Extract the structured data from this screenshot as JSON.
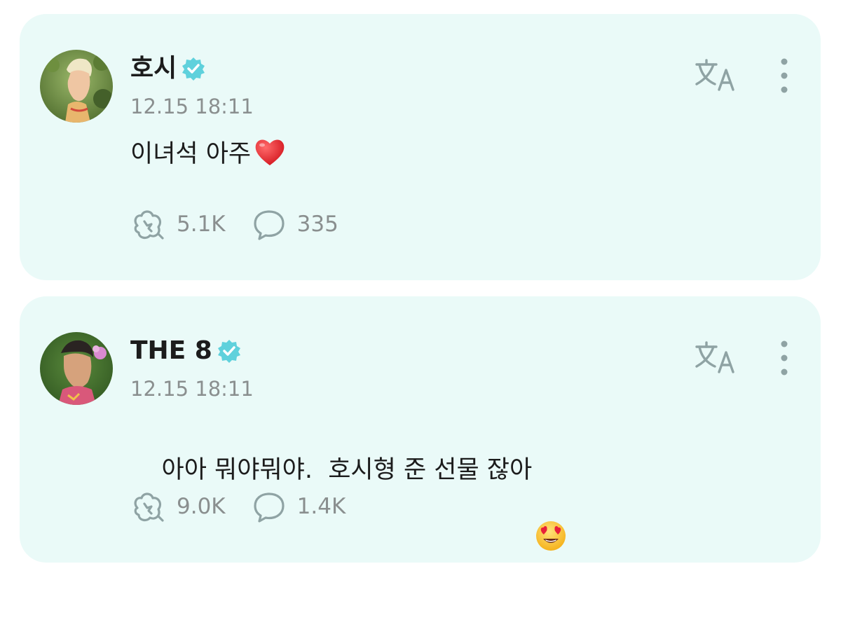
{
  "colors": {
    "card_background": "#eafaf8",
    "verified_badge": "#5fd1dc",
    "icon_gray": "#8fa3a4",
    "text_primary": "#1c1c1c",
    "text_secondary": "#8a8f8f"
  },
  "posts": [
    {
      "author": "호시",
      "verified": true,
      "timestamp": "12.15 18:11",
      "text": "이녀석 아주",
      "emoji": "red-heart",
      "likes": "5.1K",
      "comments": "335",
      "icons": {
        "translate": "translate-icon",
        "more": "more-vertical-icon",
        "like": "reaction-icon",
        "comment": "comment-bubble-icon"
      }
    },
    {
      "author": "THE 8",
      "verified": true,
      "timestamp": "12.15 18:11",
      "text": "아아 뭐야뭐야.  호시형 준 선물 잖아",
      "emoji": "heart-eyes-face",
      "likes": "9.0K",
      "comments": "1.4K",
      "icons": {
        "translate": "translate-icon",
        "more": "more-vertical-icon",
        "like": "reaction-icon",
        "comment": "comment-bubble-icon"
      }
    }
  ]
}
